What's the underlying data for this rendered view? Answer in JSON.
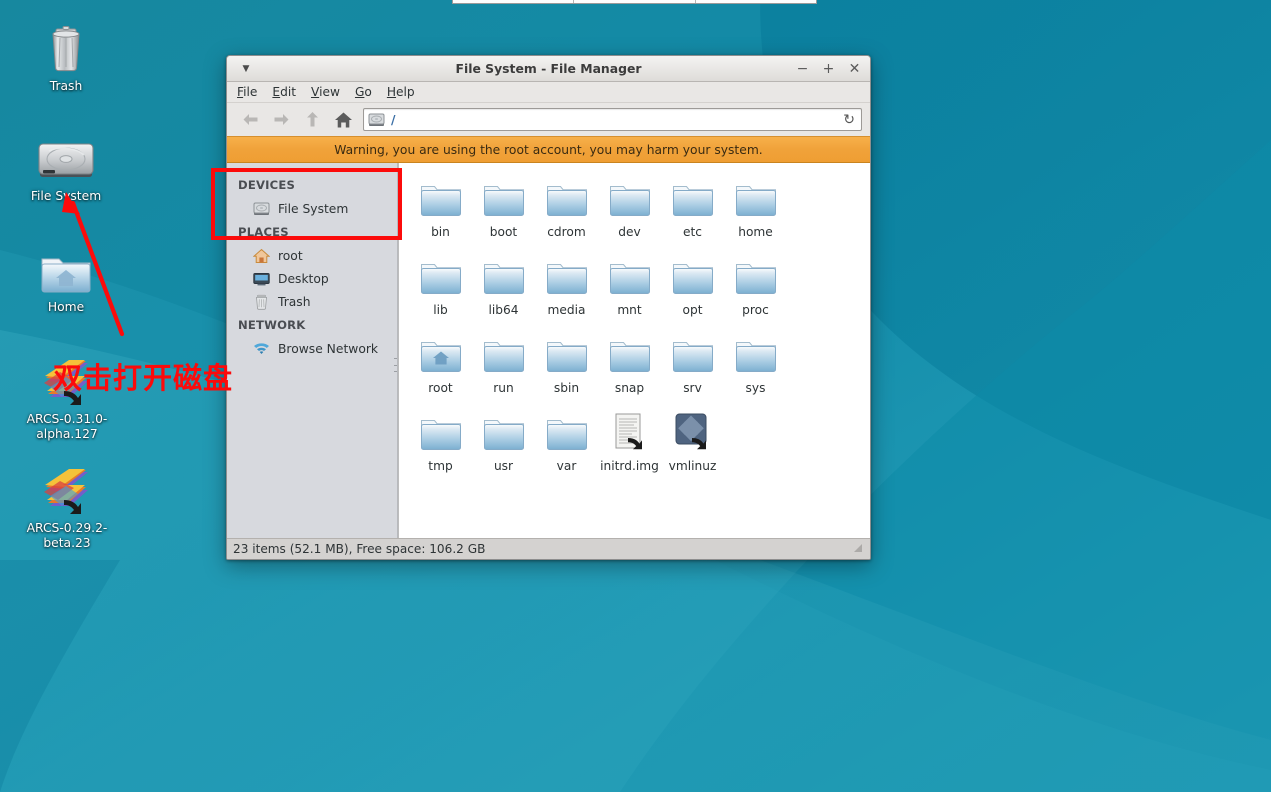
{
  "desktop": {
    "icons": [
      {
        "name": "Trash",
        "icon": "trash-icon",
        "label": "Trash"
      },
      {
        "name": "File System",
        "icon": "harddisk-icon",
        "label": "File System"
      },
      {
        "name": "Home",
        "icon": "home-folder-icon",
        "label": "Home"
      },
      {
        "name": "ARCS alpha",
        "icon": "arcs-symlink-icon",
        "label": "ARCS-0.31.0-alpha.127"
      },
      {
        "name": "ARCS beta",
        "icon": "arcs-symlink-icon",
        "label": "ARCS-0.29.2-beta.23"
      }
    ],
    "wallpaper_colors": {
      "base_dark": "#0d7e9c",
      "base_mid": "#1789a8",
      "base_light": "#2aa3bb",
      "highlight": "#3cb0c4"
    }
  },
  "annotations": {
    "box_color": "#fc0b0b",
    "arrow_color": "#fc0b0b",
    "text": "双击打开磁盘",
    "text_color": "#fc0b0b"
  },
  "window": {
    "title": "File System - File Manager",
    "titlebar": {
      "menu_arrow": "▼",
      "minimize": "−",
      "maximize": "+",
      "close": "✕"
    },
    "menubar": [
      {
        "label": "File",
        "accel": "F"
      },
      {
        "label": "Edit",
        "accel": "E"
      },
      {
        "label": "View",
        "accel": "V"
      },
      {
        "label": "Go",
        "accel": "G"
      },
      {
        "label": "Help",
        "accel": "H"
      }
    ],
    "toolbar": {
      "back": "back-arrow-icon",
      "forward": "forward-arrow-icon",
      "up": "up-arrow-icon",
      "home": "home-icon",
      "path_value": "/",
      "path_icon": "harddisk-icon",
      "reload": "↻"
    },
    "warning": {
      "text": "Warning, you are using the root account, you may harm your system.",
      "bg_color": "#f0a23a"
    },
    "sidebar": {
      "groups": [
        {
          "title": "DEVICES",
          "items": [
            {
              "label": "File System",
              "icon": "harddisk-icon"
            }
          ]
        },
        {
          "title": "PLACES",
          "items": [
            {
              "label": "root",
              "icon": "home-icon"
            },
            {
              "label": "Desktop",
              "icon": "desktop-icon"
            },
            {
              "label": "Trash",
              "icon": "trash-icon"
            }
          ]
        },
        {
          "title": "NETWORK",
          "items": [
            {
              "label": "Browse Network",
              "icon": "network-icon"
            }
          ]
        }
      ]
    },
    "files": [
      {
        "label": "bin",
        "type": "folder"
      },
      {
        "label": "boot",
        "type": "folder"
      },
      {
        "label": "cdrom",
        "type": "folder"
      },
      {
        "label": "dev",
        "type": "folder"
      },
      {
        "label": "etc",
        "type": "folder"
      },
      {
        "label": "home",
        "type": "folder"
      },
      {
        "label": "lib",
        "type": "folder"
      },
      {
        "label": "lib64",
        "type": "folder"
      },
      {
        "label": "media",
        "type": "folder"
      },
      {
        "label": "mnt",
        "type": "folder"
      },
      {
        "label": "opt",
        "type": "folder"
      },
      {
        "label": "proc",
        "type": "folder"
      },
      {
        "label": "root",
        "type": "folder-home"
      },
      {
        "label": "run",
        "type": "folder"
      },
      {
        "label": "sbin",
        "type": "folder"
      },
      {
        "label": "snap",
        "type": "folder"
      },
      {
        "label": "srv",
        "type": "folder"
      },
      {
        "label": "sys",
        "type": "folder"
      },
      {
        "label": "tmp",
        "type": "folder"
      },
      {
        "label": "usr",
        "type": "folder"
      },
      {
        "label": "var",
        "type": "folder"
      },
      {
        "label": "initrd.img",
        "type": "file-link"
      },
      {
        "label": "vmlinuz",
        "type": "binary-link"
      }
    ],
    "statusbar": {
      "text": "23 items (52.1 MB), Free space: 106.2 GB",
      "grip": "resize-grip-icon"
    }
  }
}
